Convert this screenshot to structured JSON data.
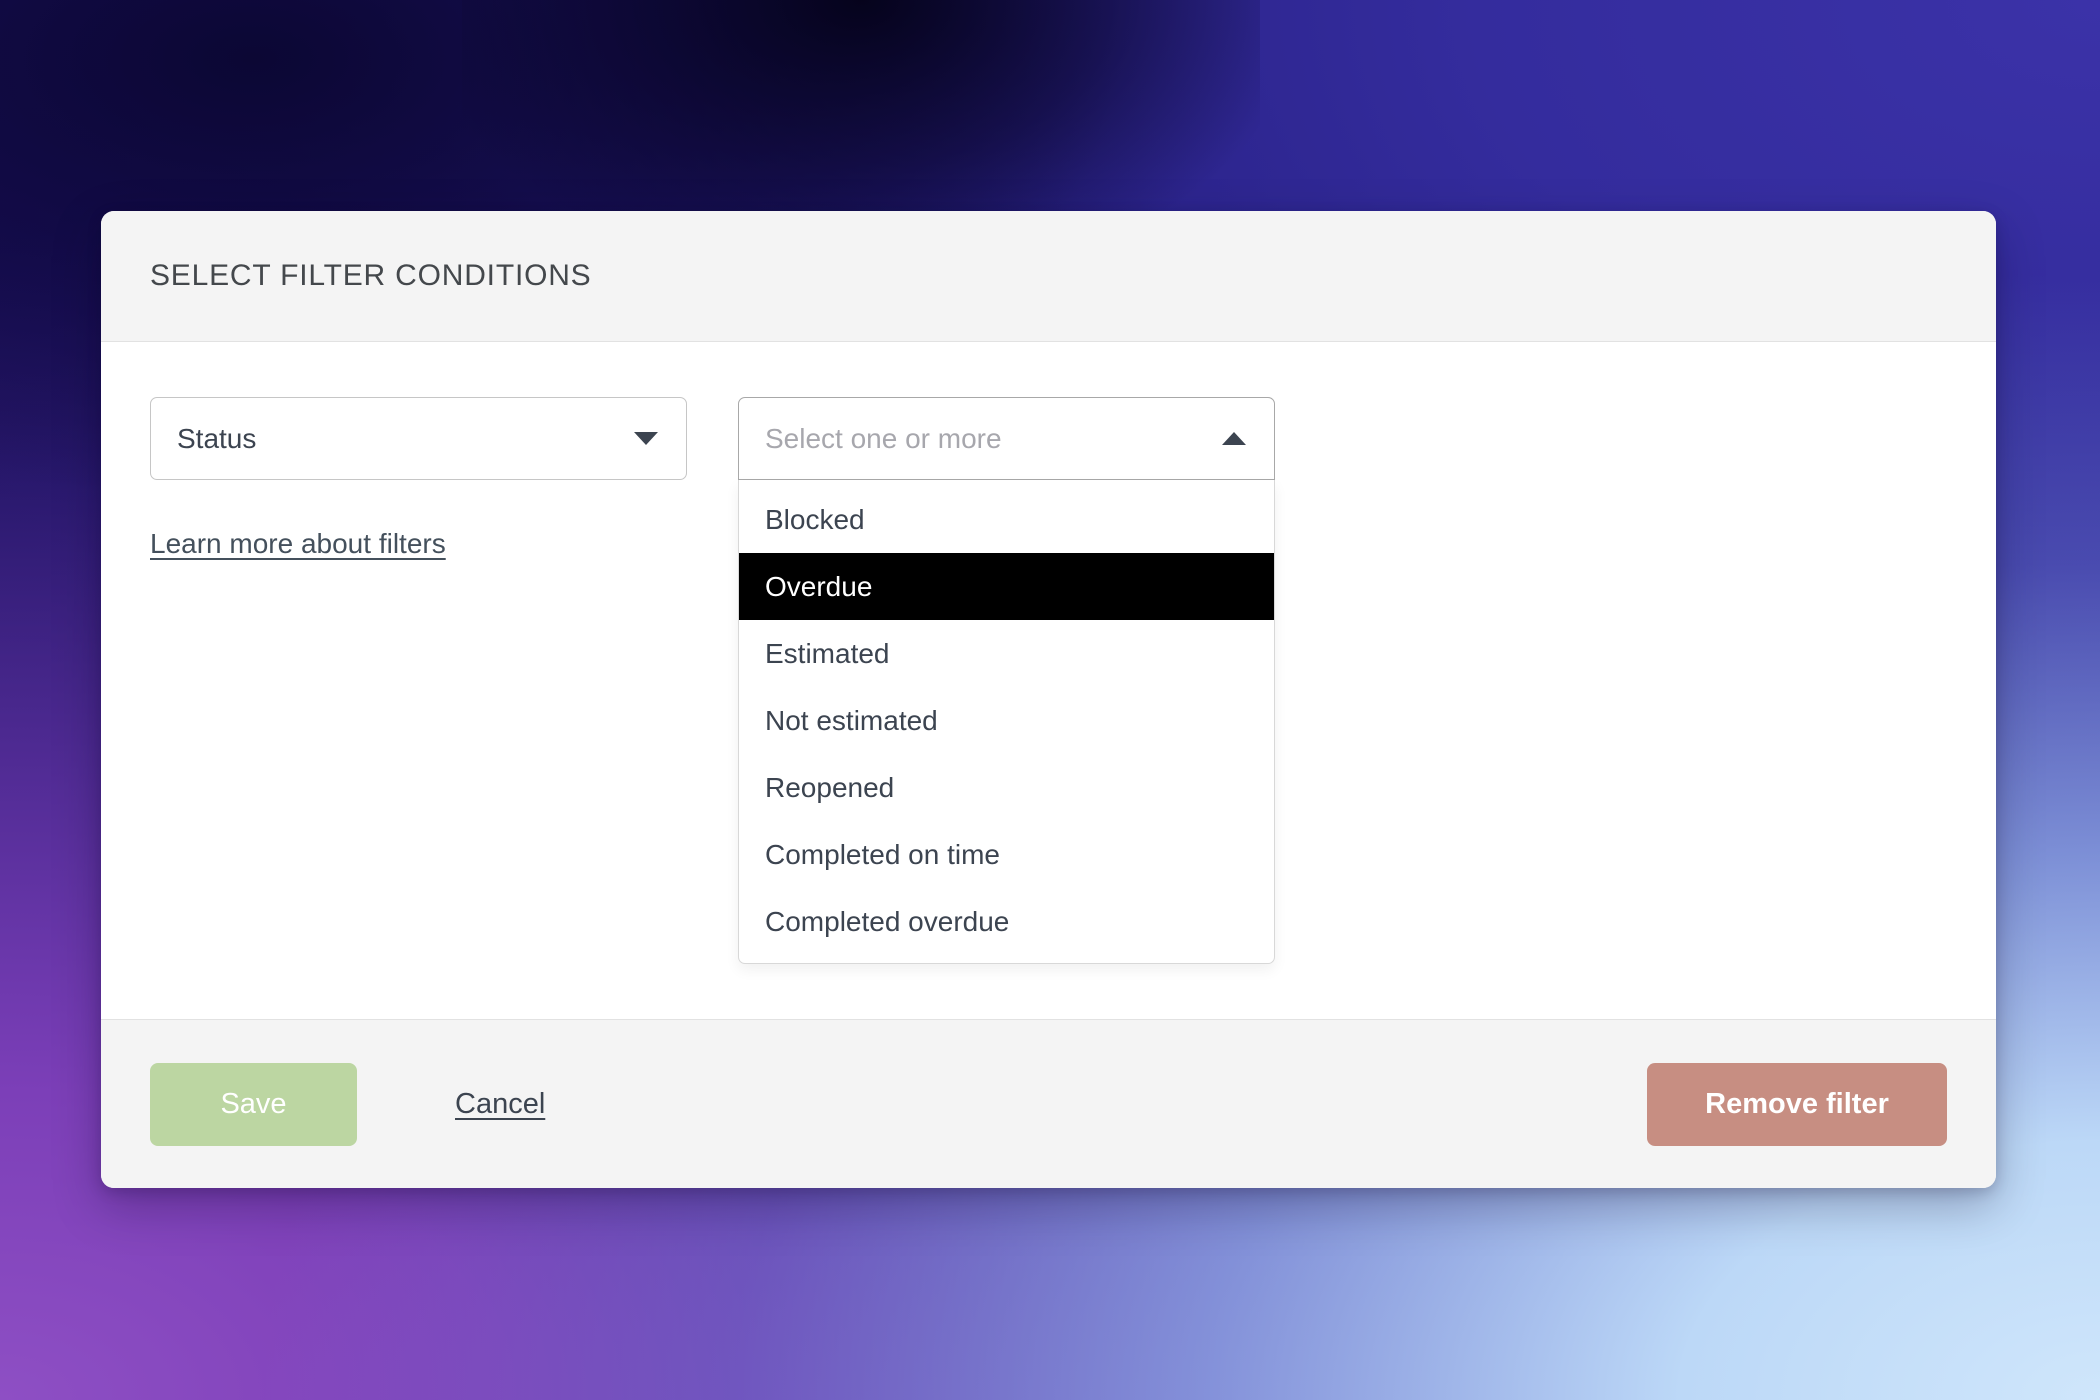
{
  "modal": {
    "title": "SELECT FILTER CONDITIONS"
  },
  "filter": {
    "field_select": {
      "value": "Status",
      "caret_icon": "caret-down-icon"
    },
    "value_select": {
      "placeholder": "Select one or more",
      "value": "",
      "caret_icon": "caret-up-icon",
      "expanded": true,
      "options": [
        {
          "label": "Blocked",
          "selected": false
        },
        {
          "label": "Overdue",
          "selected": true
        },
        {
          "label": "Estimated",
          "selected": false
        },
        {
          "label": "Not estimated",
          "selected": false
        },
        {
          "label": "Reopened",
          "selected": false
        },
        {
          "label": "Completed on time",
          "selected": false
        },
        {
          "label": "Completed overdue",
          "selected": false
        }
      ]
    },
    "learn_more_link": "Learn more about filters"
  },
  "footer": {
    "save_label": "Save",
    "cancel_label": "Cancel",
    "remove_label": "Remove filter"
  },
  "colors": {
    "save_button": "#bcd6a2",
    "remove_button": "#c78e82",
    "selected_option_bg": "#000000",
    "selected_option_text": "#ffffff",
    "header_bg": "#f4f4f4",
    "text_primary": "#3c4450"
  }
}
